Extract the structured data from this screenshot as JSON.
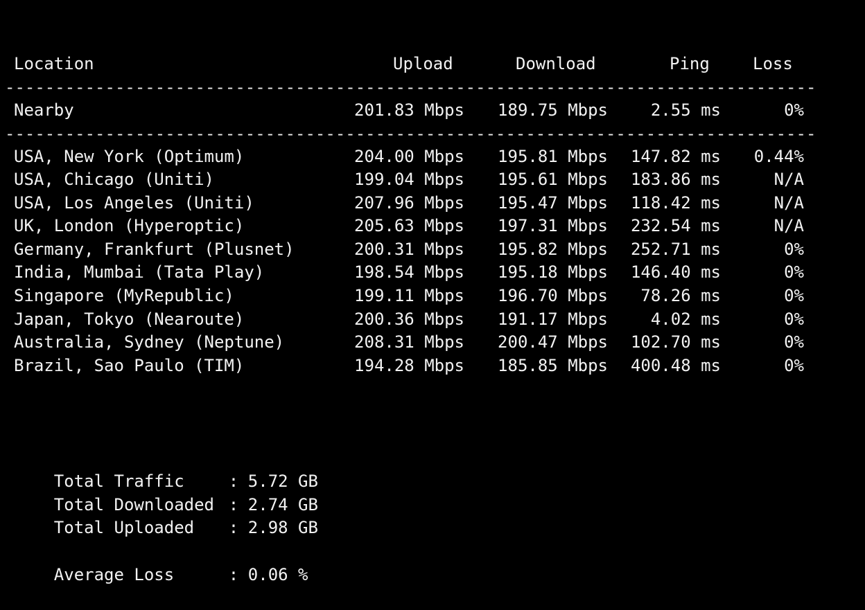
{
  "header": {
    "location": "Location",
    "upload": "Upload",
    "download": "Download",
    "ping": "Ping",
    "loss": "Loss"
  },
  "divider": "------------------------------------------------------------------------------------------------------------------------",
  "nearby": {
    "location": "Nearby",
    "upload": "201.83 Mbps",
    "download": "189.75 Mbps",
    "ping": "2.55 ms",
    "loss": "0%"
  },
  "rows": [
    {
      "location": "USA, New York (Optimum)",
      "upload": "204.00 Mbps",
      "download": "195.81 Mbps",
      "ping": "147.82 ms",
      "loss": "0.44%"
    },
    {
      "location": "USA, Chicago (Uniti)",
      "upload": "199.04 Mbps",
      "download": "195.61 Mbps",
      "ping": "183.86 ms",
      "loss": "N/A"
    },
    {
      "location": "USA, Los Angeles (Uniti)",
      "upload": "207.96 Mbps",
      "download": "195.47 Mbps",
      "ping": "118.42 ms",
      "loss": "N/A"
    },
    {
      "location": "UK, London (Hyperoptic)",
      "upload": "205.63 Mbps",
      "download": "197.31 Mbps",
      "ping": "232.54 ms",
      "loss": "N/A"
    },
    {
      "location": "Germany, Frankfurt (Plusnet)",
      "upload": "200.31 Mbps",
      "download": "195.82 Mbps",
      "ping": "252.71 ms",
      "loss": "0%"
    },
    {
      "location": "India, Mumbai (Tata Play)",
      "upload": "198.54 Mbps",
      "download": "195.18 Mbps",
      "ping": "146.40 ms",
      "loss": "0%"
    },
    {
      "location": "Singapore (MyRepublic)",
      "upload": "199.11 Mbps",
      "download": "196.70 Mbps",
      "ping": "78.26 ms",
      "loss": "0%"
    },
    {
      "location": "Japan, Tokyo (Nearoute)",
      "upload": "200.36 Mbps",
      "download": "191.17 Mbps",
      "ping": "4.02 ms",
      "loss": "0%"
    },
    {
      "location": "Australia, Sydney (Neptune)",
      "upload": "208.31 Mbps",
      "download": "200.47 Mbps",
      "ping": "102.70 ms",
      "loss": "0%"
    },
    {
      "location": "Brazil, Sao Paulo (TIM)",
      "upload": "194.28 Mbps",
      "download": "185.85 Mbps",
      "ping": "400.48 ms",
      "loss": "0%"
    }
  ],
  "summary": {
    "separator": ":",
    "total_traffic_label": "Total Traffic",
    "total_traffic_value": "5.72 GB",
    "total_downloaded_label": "Total Downloaded",
    "total_downloaded_value": "2.74 GB",
    "total_uploaded_label": "Total Uploaded",
    "total_uploaded_value": "2.98 GB",
    "average_loss_label": "Average Loss",
    "average_loss_value": "0.06 %"
  },
  "colors": {
    "background": "#000000",
    "text": "#f2f2f2"
  }
}
